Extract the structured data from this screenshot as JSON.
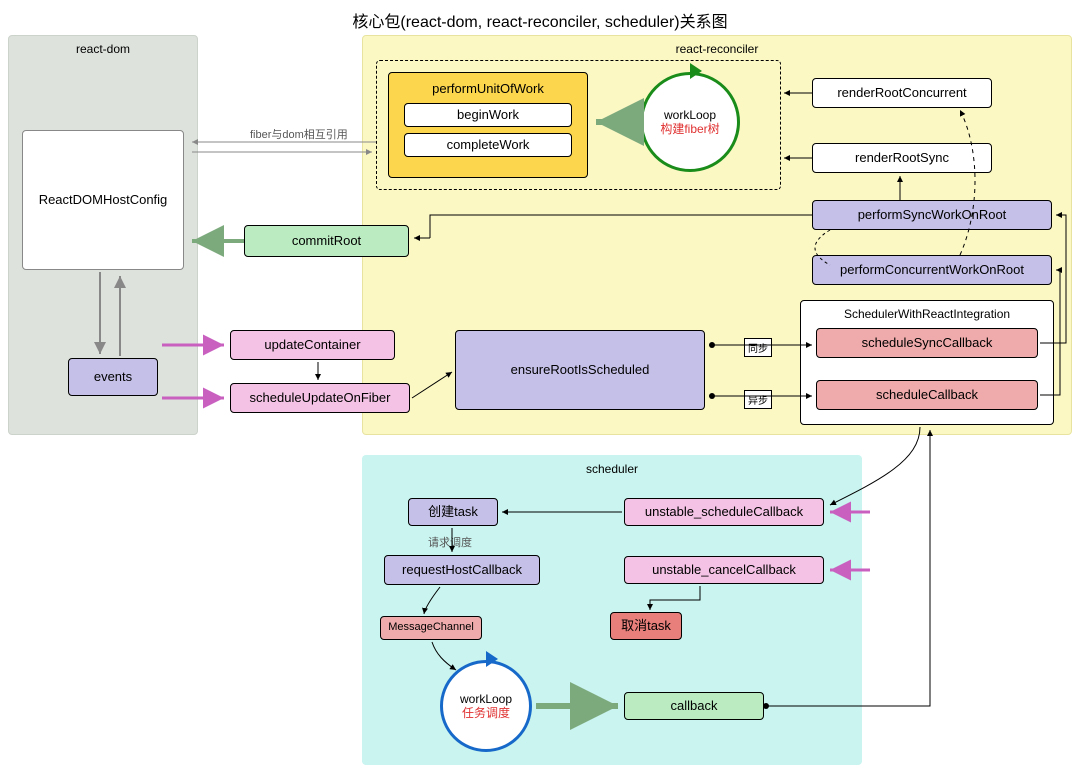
{
  "title": "核心包(react-dom, react-reconciler, scheduler)关系图",
  "panels": {
    "reactdom": "react-dom",
    "reconciler": "react-reconciler",
    "scheduler": "scheduler",
    "swri": "SchedulerWithReactIntegration"
  },
  "nodes": {
    "reactDomHostConfig": "ReactDOMHostConfig",
    "events": "events",
    "commitRoot": "commitRoot",
    "updateContainer": "updateContainer",
    "scheduleUpdateOnFiber": "scheduleUpdateOnFiber",
    "ensureRootIsScheduled": "ensureRootIsScheduled",
    "performUnitOfWork": "performUnitOfWork",
    "beginWork": "beginWork",
    "completeWork": "completeWork",
    "workLoop1": "workLoop",
    "workLoop1_sub": "构建fiber树",
    "renderRootConcurrent": "renderRootConcurrent",
    "renderRootSync": "renderRootSync",
    "performSyncWorkOnRoot": "performSyncWorkOnRoot",
    "performConcurrentWorkOnRoot": "performConcurrentWorkOnRoot",
    "scheduleSyncCallback": "scheduleSyncCallback",
    "scheduleCallback": "scheduleCallback",
    "createTask": "创建task",
    "requestHostCallback": "requestHostCallback",
    "messageChannel": "MessageChannel",
    "workLoop2": "workLoop",
    "workLoop2_sub": "任务调度",
    "callback": "callback",
    "unstableScheduleCallback": "unstable_scheduleCallback",
    "unstableCancelCallback": "unstable_cancelCallback",
    "cancelTask": "取消task"
  },
  "labels": {
    "fiberDomRef": "fiber与dom相互引用",
    "requestSchedule": "请求调度",
    "sync": "同步",
    "async": "异步"
  }
}
